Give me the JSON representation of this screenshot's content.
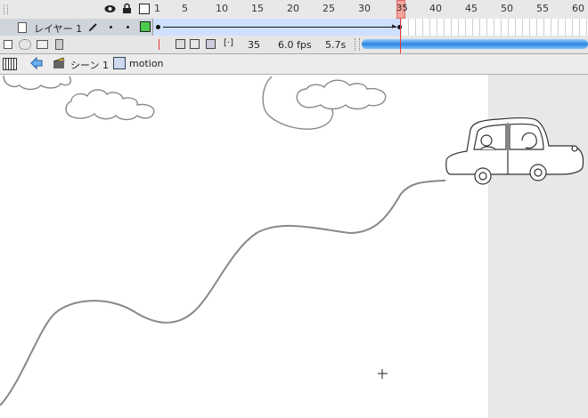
{
  "timeline": {
    "frame_numbers": [
      "1",
      "5",
      "10",
      "15",
      "20",
      "25",
      "30",
      "35",
      "40",
      "45",
      "50",
      "55",
      "60"
    ],
    "current_frame_marker": "35"
  },
  "layer": {
    "name": "レイヤー 1"
  },
  "status": {
    "current_frame": "35",
    "frame_rate": "6.0 fps",
    "elapsed_time": "5.7s"
  },
  "edit_bar": {
    "scene_label": "シーン 1",
    "symbol_label": "motion"
  },
  "colors": {
    "layer_outline_color": "#4ccc4c",
    "playhead": "#e33333",
    "scroll_thumb": "#2d86e0"
  }
}
